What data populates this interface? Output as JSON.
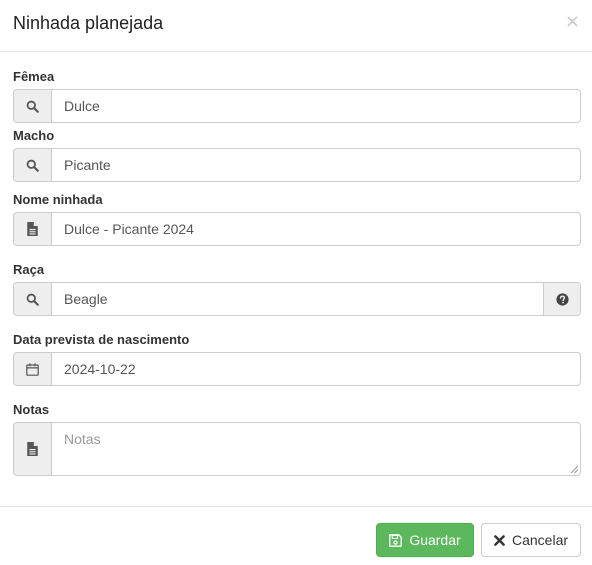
{
  "modal": {
    "title": "Ninhada planejada",
    "close_glyph": "×"
  },
  "fields": {
    "female": {
      "label": "Fêmea",
      "value": "Dulce",
      "icon": "search-icon"
    },
    "male": {
      "label": "Macho",
      "value": "Picante",
      "icon": "search-icon"
    },
    "litter_name": {
      "label": "Nome ninhada",
      "value": "Dulce - Picante 2024",
      "icon": "document-icon"
    },
    "breed": {
      "label": "Raça",
      "value": "Beagle",
      "icon": "search-icon",
      "help_icon": "question-circle-icon"
    },
    "due_date": {
      "label": "Data prevista de nascimento",
      "value": "2024-10-22",
      "icon": "calendar-icon"
    },
    "notes": {
      "label": "Notas",
      "value": "",
      "placeholder": "Notas",
      "icon": "document-icon"
    }
  },
  "footer": {
    "save_label": "Guardar",
    "save_icon": "floppy-disk-icon",
    "cancel_label": "Cancelar",
    "cancel_icon": "close-x-icon"
  },
  "colors": {
    "save_button": "#5cb85c",
    "addon_background": "#eeeeee",
    "border": "#cccccc"
  }
}
